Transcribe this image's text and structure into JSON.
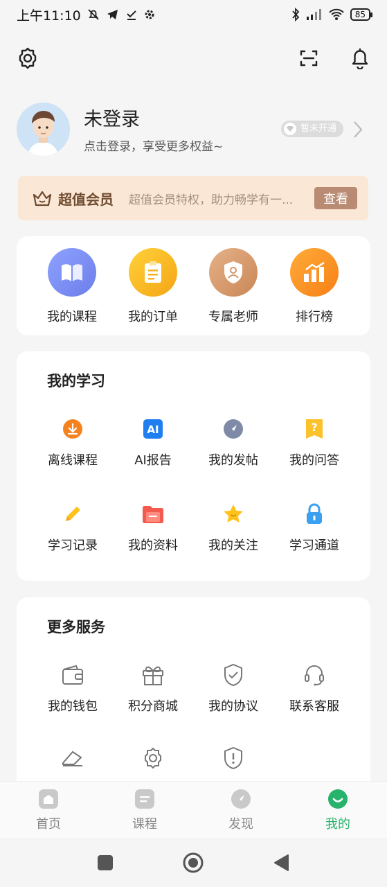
{
  "status": {
    "time": "上午11:10",
    "battery": "85"
  },
  "topbar": {
    "settings_icon": "gear-icon",
    "scan_icon": "scan-icon",
    "bell_icon": "bell-icon"
  },
  "profile": {
    "name": "未登录",
    "subtitle": "点击登录，享受更多权益~",
    "vip_badge": "暂未开通"
  },
  "member": {
    "title": "超值会员",
    "desc": "超值会员特权，助力畅学有一...",
    "button": "查看"
  },
  "quick": [
    {
      "label": "我的课程",
      "icon": "book-icon",
      "color": "#7b8ef5"
    },
    {
      "label": "我的订单",
      "icon": "clipboard-icon",
      "color": "#f8b31a"
    },
    {
      "label": "专属老师",
      "icon": "teacher-shield-icon",
      "color": "#d89b6a"
    },
    {
      "label": "排行榜",
      "icon": "ranking-icon",
      "color": "#f98e1c"
    }
  ],
  "study": {
    "title": "我的学习",
    "items": [
      {
        "label": "离线课程",
        "icon": "download-icon"
      },
      {
        "label": "AI报告",
        "icon": "ai-icon"
      },
      {
        "label": "我的发帖",
        "icon": "compass-icon"
      },
      {
        "label": "我的问答",
        "icon": "question-icon"
      },
      {
        "label": "学习记录",
        "icon": "pencil-icon"
      },
      {
        "label": "我的资料",
        "icon": "folder-icon"
      },
      {
        "label": "我的关注",
        "icon": "star-icon"
      },
      {
        "label": "学习通道",
        "icon": "lock-icon"
      }
    ]
  },
  "services": {
    "title": "更多服务",
    "items": [
      {
        "label": "我的钱包",
        "icon": "wallet-icon"
      },
      {
        "label": "积分商城",
        "icon": "gift-icon"
      },
      {
        "label": "我的协议",
        "icon": "shield-check-icon"
      },
      {
        "label": "联系客服",
        "icon": "headset-icon"
      }
    ]
  },
  "tabs": [
    {
      "label": "首页",
      "icon": "home-icon"
    },
    {
      "label": "课程",
      "icon": "course-icon"
    },
    {
      "label": "发现",
      "icon": "discover-icon"
    },
    {
      "label": "我的",
      "icon": "me-icon",
      "active": true
    }
  ],
  "colors": {
    "accent": "#27b36b",
    "member_bg": "#fbe7d6",
    "member_button": "#b88b72"
  }
}
